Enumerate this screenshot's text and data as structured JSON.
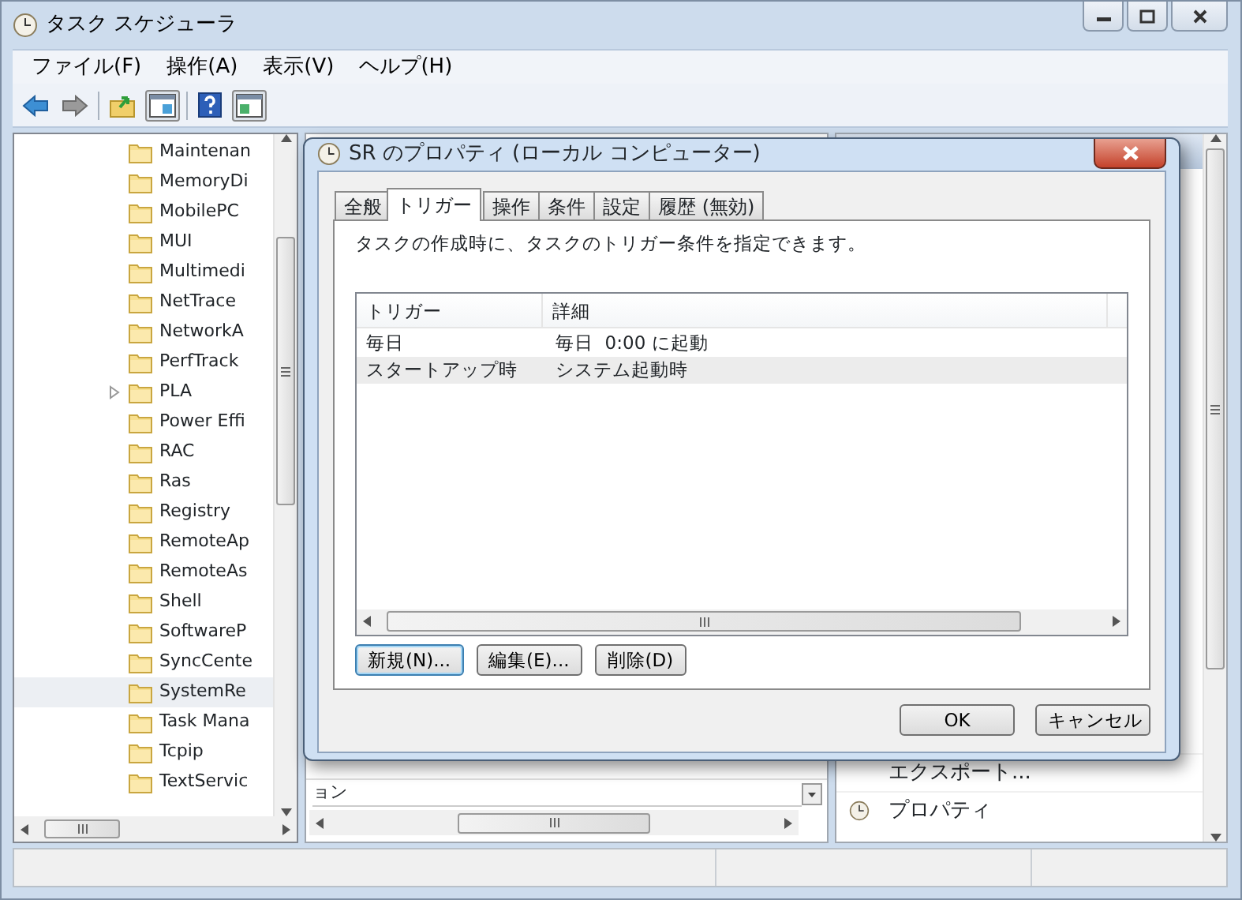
{
  "window": {
    "title": "タスク スケジューラ"
  },
  "menu": [
    "ファイル(F)",
    "操作(A)",
    "表示(V)",
    "ヘルプ(H)"
  ],
  "tree": {
    "items": [
      {
        "label": "Maintenan",
        "expandable": false,
        "selected": false
      },
      {
        "label": "MemoryDi",
        "expandable": false,
        "selected": false
      },
      {
        "label": "MobilePC",
        "expandable": false,
        "selected": false
      },
      {
        "label": "MUI",
        "expandable": false,
        "selected": false
      },
      {
        "label": "Multimedi",
        "expandable": false,
        "selected": false
      },
      {
        "label": "NetTrace",
        "expandable": false,
        "selected": false
      },
      {
        "label": "NetworkA",
        "expandable": false,
        "selected": false
      },
      {
        "label": "PerfTrack",
        "expandable": false,
        "selected": false
      },
      {
        "label": "PLA",
        "expandable": true,
        "selected": false
      },
      {
        "label": "Power Effi",
        "expandable": false,
        "selected": false
      },
      {
        "label": "RAC",
        "expandable": false,
        "selected": false
      },
      {
        "label": "Ras",
        "expandable": false,
        "selected": false
      },
      {
        "label": "Registry",
        "expandable": false,
        "selected": false
      },
      {
        "label": "RemoteAp",
        "expandable": false,
        "selected": false
      },
      {
        "label": "RemoteAs",
        "expandable": false,
        "selected": false
      },
      {
        "label": "Shell",
        "expandable": false,
        "selected": false
      },
      {
        "label": "SoftwareP",
        "expandable": false,
        "selected": false
      },
      {
        "label": "SyncCente",
        "expandable": false,
        "selected": false
      },
      {
        "label": "SystemRe",
        "expandable": false,
        "selected": true
      },
      {
        "label": "Task Mana",
        "expandable": false,
        "selected": false
      },
      {
        "label": "Tcpip",
        "expandable": false,
        "selected": false
      },
      {
        "label": "TextServic",
        "expandable": false,
        "selected": false
      }
    ]
  },
  "middle_pane": {
    "text": "ョン"
  },
  "actions": [
    {
      "label": "エクスポート...",
      "kind": "plain"
    },
    {
      "label": "プロパティ",
      "kind": "clock"
    }
  ],
  "dialog": {
    "title": "SR のプロパティ (ローカル コンピューター)",
    "tabs": [
      {
        "label": "全般",
        "selected": false
      },
      {
        "label": "トリガー",
        "selected": true
      },
      {
        "label": "操作",
        "selected": false
      },
      {
        "label": "条件",
        "selected": false
      },
      {
        "label": "設定",
        "selected": false
      },
      {
        "label": "履歴 (無効)",
        "selected": false
      }
    ],
    "description": "タスクの作成時に、タスクのトリガー条件を指定できます。",
    "table": {
      "columns": [
        "トリガー",
        "詳細"
      ],
      "rows": [
        {
          "cells": [
            "毎日",
            "毎日  0:00 に起動"
          ],
          "selected": false
        },
        {
          "cells": [
            "スタートアップ時",
            "システム起動時"
          ],
          "selected": true
        }
      ]
    },
    "buttons": [
      {
        "label": "新規(N)...",
        "default": true
      },
      {
        "label": "編集(E)...",
        "default": false
      },
      {
        "label": "削除(D)",
        "default": false
      }
    ],
    "footer_buttons": [
      "OK",
      "キャンセル"
    ]
  }
}
